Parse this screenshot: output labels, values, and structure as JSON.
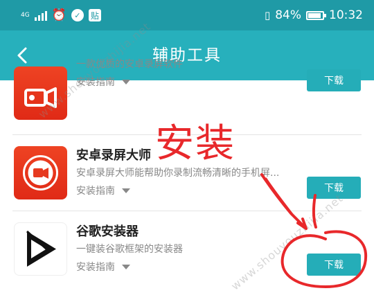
{
  "status_bar": {
    "network": "4G",
    "battery": "84%",
    "time": "10:32",
    "badge": "贴"
  },
  "nav": {
    "title": "辅助工具"
  },
  "apps": [
    {
      "name": "",
      "description": "一款优质的安卓录屏软件",
      "guide": "安装指南",
      "download": "下载"
    },
    {
      "name": "安卓录屏大师",
      "description": "安卓录屏大师能帮助你录制流畅清晰的手机屏...",
      "guide": "安装指南",
      "download": "下载"
    },
    {
      "name": "谷歌安装器",
      "description": "一键装谷歌框架的安装器",
      "guide": "安装指南",
      "download": "下载"
    }
  ],
  "overlay": {
    "label": "安装"
  },
  "watermark": {
    "text": "www.shouyouzhijia.net"
  },
  "colors": {
    "status_bar": "#1f9aa6",
    "nav_bar": "#27b0bc",
    "button": "#25adb8",
    "annotation_red": "#e8282b"
  }
}
